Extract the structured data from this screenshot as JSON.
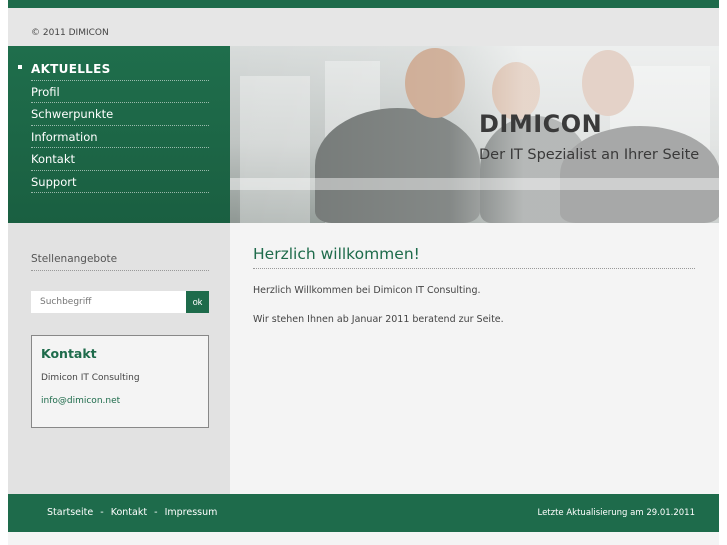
{
  "header": {
    "copyright": "© 2011 DIMICON"
  },
  "nav": {
    "items": [
      {
        "label": "AKTUELLES",
        "active": true
      },
      {
        "label": "Profil",
        "active": false
      },
      {
        "label": "Schwerpunkte",
        "active": false
      },
      {
        "label": "Information",
        "active": false
      },
      {
        "label": "Kontakt",
        "active": false
      },
      {
        "label": "Support",
        "active": false
      }
    ]
  },
  "banner": {
    "brand": "DIMICON",
    "tagline": "Der IT Spezialist an Ihrer Seite"
  },
  "sidebar": {
    "title": "Stellenangebote",
    "search": {
      "placeholder": "Suchbegriff",
      "button_label": "ok"
    },
    "contact": {
      "title": "Kontakt",
      "company": "Dimicon IT Consulting",
      "email": "info@dimicon.net"
    }
  },
  "main": {
    "title": "Herzlich willkommen!",
    "paragraphs": [
      "Herzlich Willkommen bei Dimicon IT Consulting.",
      "Wir stehen Ihnen ab Januar 2011 beratend zur Seite."
    ]
  },
  "footer": {
    "links": [
      "Startseite",
      "Kontakt",
      "Impressum"
    ],
    "separator": "-",
    "updated": "Letzte Aktualisierung am 29.01.2011"
  },
  "colors": {
    "brand_green": "#1e6b4b",
    "sidebar_bg": "#e2e2e2",
    "content_bg": "#f4f4f4"
  }
}
